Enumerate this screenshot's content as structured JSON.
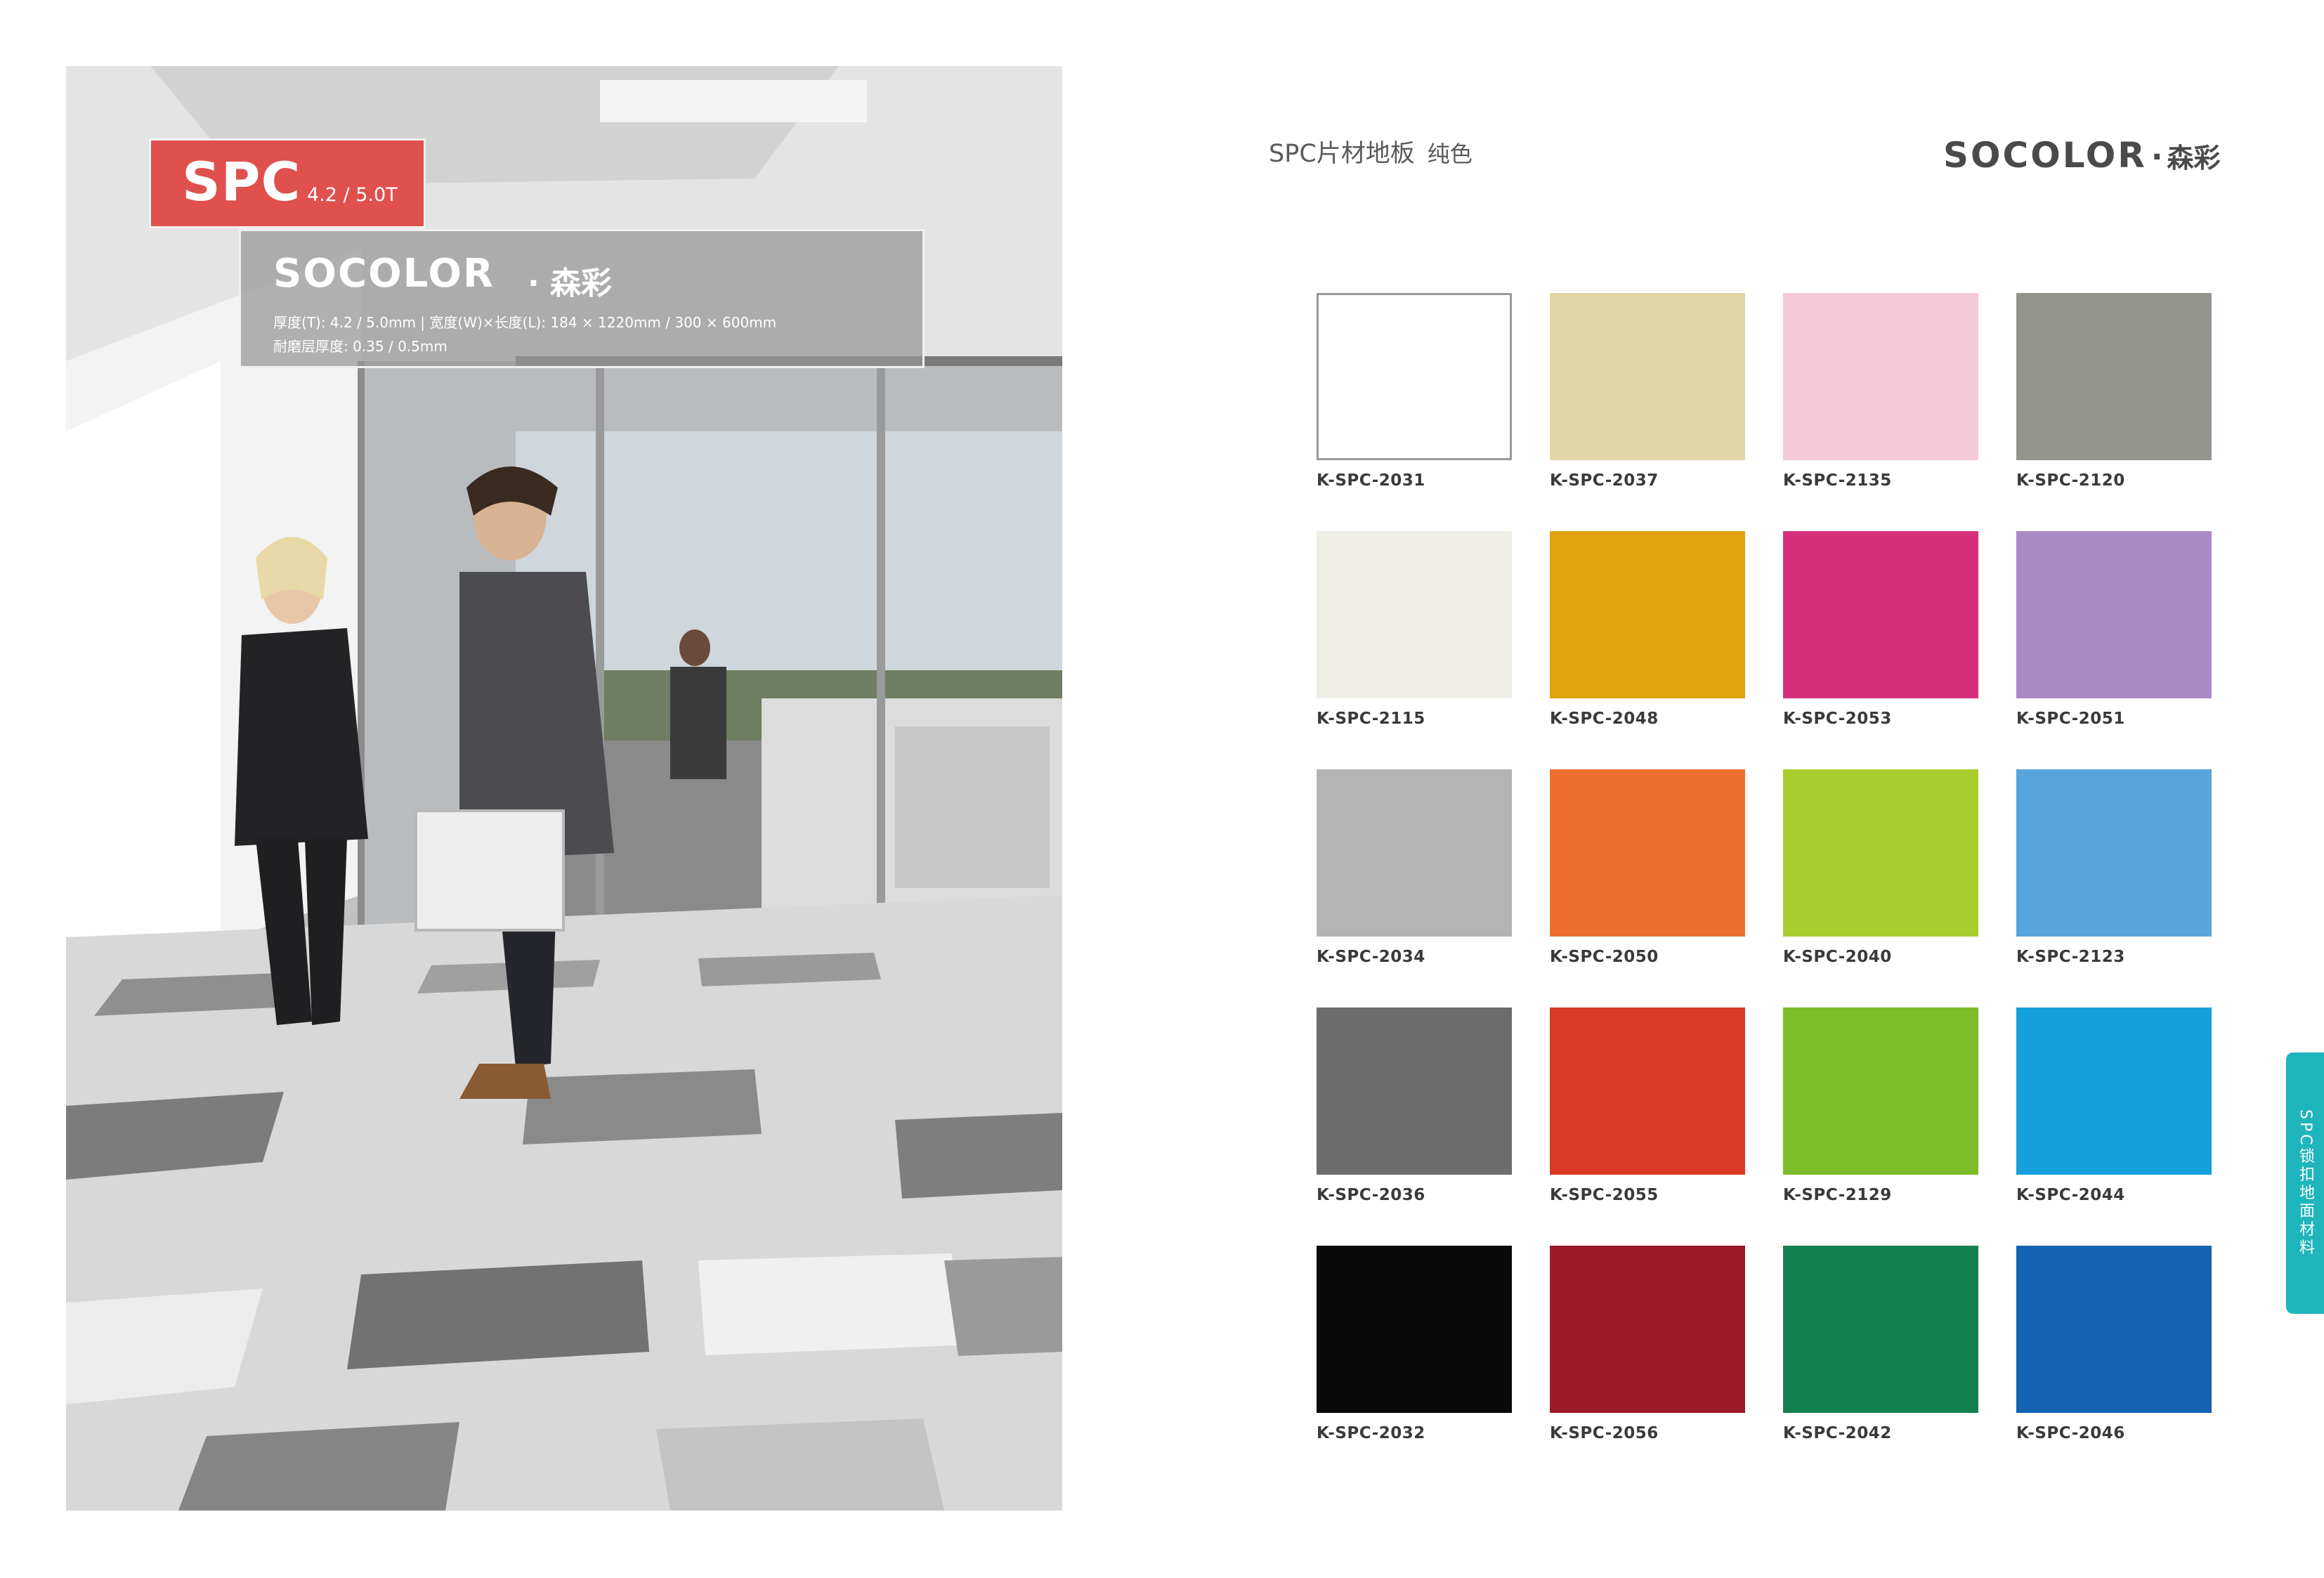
{
  "photo": {
    "badge_main": "SPC",
    "badge_sub": "4.2 / 5.0T",
    "brand_en": "SOCOLOR",
    "brand_dot": "·",
    "brand_cn": "森彩",
    "spec_line1": "厚度(T): 4.2 / 5.0mm  |  宽度(W)×长度(L): 184 × 1220mm / 300 × 600mm",
    "spec_line2": "耐磨层厚度: 0.35 / 0.5mm"
  },
  "header": {
    "title": "SPC片材地板",
    "subtitle": "纯色",
    "brand_en": "SOCOLOR",
    "brand_dot": "·",
    "brand_cn": "森彩"
  },
  "swatches": [
    {
      "code": "K-SPC-2031",
      "color": "#ffffff",
      "border": true
    },
    {
      "code": "K-SPC-2037",
      "color": "#e2d5a6"
    },
    {
      "code": "K-SPC-2135",
      "color": "#f6c9d9"
    },
    {
      "code": "K-SPC-2120",
      "color": "#94968d"
    },
    {
      "code": "K-SPC-2115",
      "color": "#efefe7"
    },
    {
      "code": "K-SPC-2048",
      "color": "#e0a20e"
    },
    {
      "code": "K-SPC-2053",
      "color": "#d6307d"
    },
    {
      "code": "K-SPC-2051",
      "color": "#aa8bc6"
    },
    {
      "code": "K-SPC-2034",
      "color": "#b4b4b4"
    },
    {
      "code": "K-SPC-2050",
      "color": "#ee6f2d"
    },
    {
      "code": "K-SPC-2040",
      "color": "#a9cd2d"
    },
    {
      "code": "K-SPC-2123",
      "color": "#58a5dd"
    },
    {
      "code": "K-SPC-2036",
      "color": "#6c6c6c"
    },
    {
      "code": "K-SPC-2055",
      "color": "#d93a23"
    },
    {
      "code": "K-SPC-2129",
      "color": "#7cbd29"
    },
    {
      "code": "K-SPC-2044",
      "color": "#14a0dc"
    },
    {
      "code": "K-SPC-2032",
      "color": "#0a0a0a"
    },
    {
      "code": "K-SPC-2056",
      "color": "#9c1b28"
    },
    {
      "code": "K-SPC-2042",
      "color": "#138150"
    },
    {
      "code": "K-SPC-2046",
      "color": "#1462b1"
    }
  ],
  "side_tab": "SPC锁扣地面材料",
  "colors": {
    "badge": "#e0504c",
    "side_tab": "#1fb5bd"
  }
}
